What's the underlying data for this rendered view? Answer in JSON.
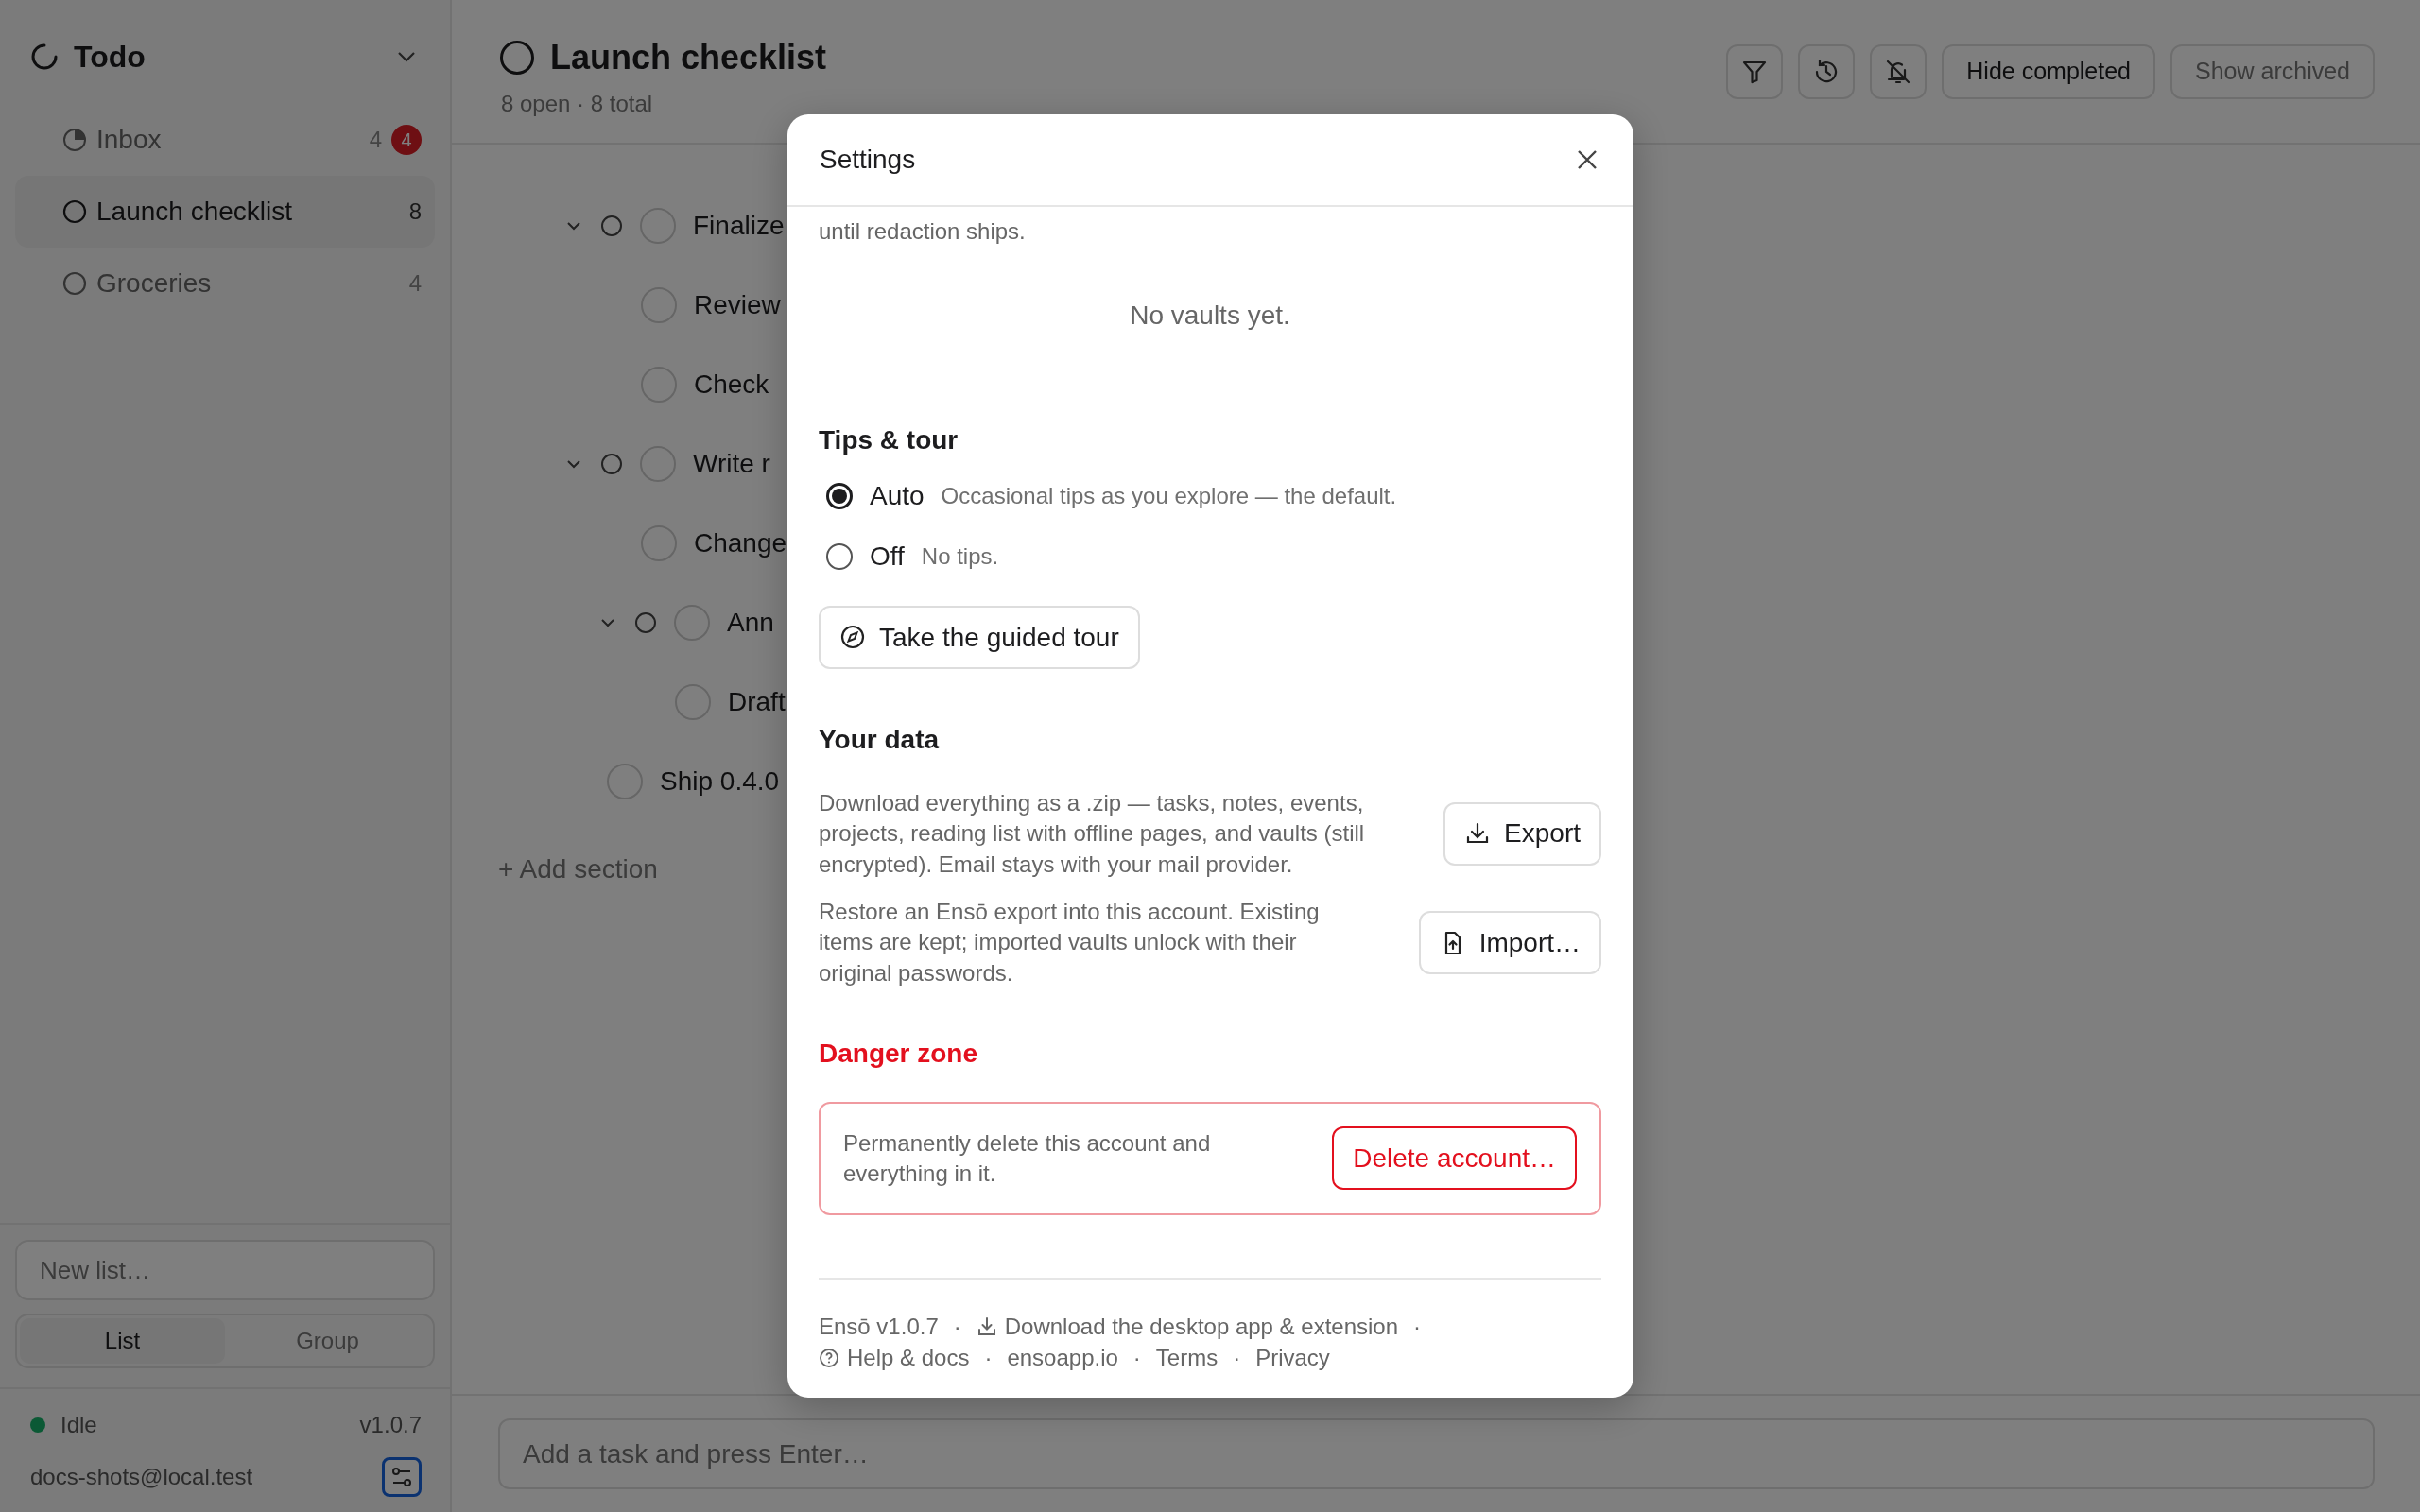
{
  "sidebar": {
    "workspace": "Todo",
    "lists": [
      {
        "kind": "inbox",
        "name": "Inbox",
        "count": "4",
        "badge": "4",
        "selected": false
      },
      {
        "kind": "list",
        "name": "Launch checklist",
        "count": "8",
        "selected": true
      },
      {
        "kind": "list",
        "name": "Groceries",
        "count": "4",
        "selected": false
      }
    ],
    "new_list": {
      "placeholder": "New list…"
    },
    "view_toggle": [
      {
        "label": "List",
        "selected": true
      },
      {
        "label": "Group",
        "selected": false
      }
    ],
    "status": {
      "label": "Idle"
    },
    "version": "v1.0.7",
    "account": "docs-shots@local.test"
  },
  "main": {
    "title": "Launch checklist",
    "summary": "8 open · 8 total",
    "filters": [
      {
        "label": "Hide completed",
        "on": true
      },
      {
        "label": "Show archived",
        "on": false
      }
    ],
    "tasks": [
      {
        "title": "Finalize",
        "checked": false,
        "expanded": true,
        "children": [
          {
            "title": "Review",
            "checked": false
          },
          {
            "title": "Check",
            "checked": false
          }
        ]
      },
      {
        "title": "Write r",
        "checked": false,
        "expanded": true,
        "children": [
          {
            "title": "Change",
            "checked": false
          },
          {
            "title": "Ann",
            "checked": false,
            "expanded": true,
            "children": [
              {
                "title": "Draft",
                "checked": false
              }
            ]
          }
        ]
      },
      {
        "title": "Ship 0.4.0",
        "checked": false
      }
    ],
    "add_section": "+ Add section",
    "add_task": {
      "placeholder": "Add a task and press Enter…"
    }
  },
  "settings": {
    "title": "Settings",
    "intro": "until redaction ships.",
    "vaults_empty": "No vaults yet.",
    "tips": {
      "heading": "Tips & tour",
      "options": [
        {
          "label": "Auto",
          "hint": "Occasional tips as you explore — the default.",
          "selected": true
        },
        {
          "label": "Off",
          "hint": "No tips.",
          "selected": false
        }
      ],
      "tour_button": "Take the guided tour"
    },
    "data": {
      "heading": "Your data",
      "rows": [
        {
          "kind": "export",
          "text": "Download everything as a .zip — tasks, notes, events, projects, reading list with offline pages, and vaults (still encrypted). Email stays with your mail provider.",
          "button": "Export"
        },
        {
          "kind": "import",
          "text": "Restore an Ensō export into this account. Existing items are kept; imported vaults unlock with their original passwords.",
          "button": "Import…"
        }
      ]
    },
    "danger": {
      "heading": "Danger zone",
      "text": "Permanently delete this account and everything in it.",
      "button": "Delete account…"
    },
    "footer": [
      [
        {
          "kind": "text",
          "text": "Ensō v1.0.7"
        },
        {
          "kind": "sep",
          "text": "·"
        },
        {
          "kind": "download",
          "text": "Download the desktop app & extension"
        },
        {
          "kind": "sep",
          "text": "·"
        }
      ],
      [
        {
          "kind": "help",
          "text": "Help & docs"
        },
        {
          "kind": "sep",
          "text": "·"
        },
        {
          "kind": "link",
          "text": "ensoapp.io"
        },
        {
          "kind": "sep",
          "text": "·"
        },
        {
          "kind": "link",
          "text": "Terms"
        },
        {
          "kind": "sep",
          "text": "·"
        },
        {
          "kind": "link",
          "text": "Privacy"
        }
      ]
    ]
  }
}
